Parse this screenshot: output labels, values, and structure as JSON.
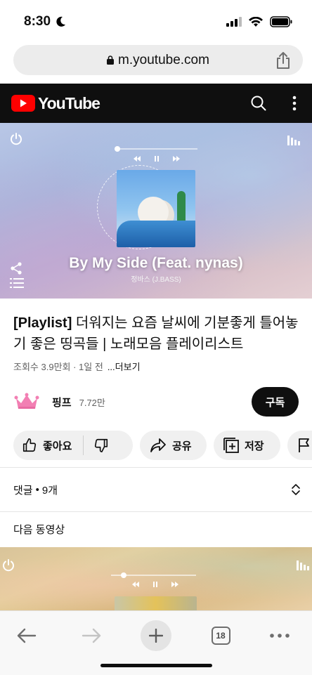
{
  "status_bar": {
    "time": "8:30"
  },
  "browser": {
    "url": "m.youtube.com",
    "tab_count": "18"
  },
  "header": {
    "logo_text": "YouTube"
  },
  "player": {
    "song_title": "By My Side (Feat. nynas)",
    "artist": "정바스 (J.BASS)"
  },
  "video": {
    "title_prefix": "[Playlist]",
    "title_rest": " 더워지는 요즘 날씨에 기분좋게 틀어놓기 좋은 띵곡들 | 노래모음 플레이리스트",
    "meta": "조회수 3.9만회 · 1일 전",
    "more_label": "...더보기"
  },
  "channel": {
    "name": "핑프",
    "subscribers": "7.72만",
    "subscribe_label": "구독"
  },
  "actions": {
    "like_label": "좋아요",
    "share_label": "공유",
    "save_label": "저장"
  },
  "comments": {
    "label": "댓글",
    "count": "9개"
  },
  "next": {
    "label": "다음 동영상"
  },
  "colors": {
    "yt_red": "#ff0000",
    "header_bg": "#0f0f0f",
    "subscribe_bg": "#0f0f0f",
    "pill_bg": "#f0f0f0"
  },
  "icons": [
    "moon-icon",
    "signal-icon",
    "wifi-icon",
    "battery-icon",
    "lock-icon",
    "share-icon",
    "search-icon",
    "more-vert-icon",
    "power-icon",
    "share-nodes-icon",
    "playlist-icon",
    "equalizer-icon",
    "thumbs-up-icon",
    "thumbs-down-icon",
    "share-arrow-icon",
    "add-to-playlist-icon",
    "flag-icon",
    "chevron-updown-icon",
    "back-icon",
    "forward-icon",
    "plus-icon",
    "tabs-icon",
    "more-horiz-icon"
  ]
}
